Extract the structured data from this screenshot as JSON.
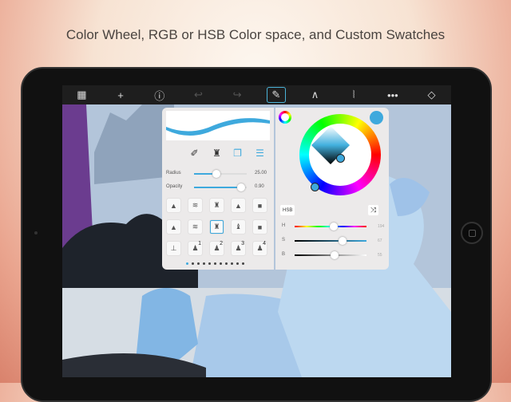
{
  "headline": "Color Wheel, RGB or HSB Color space, and Custom Swatches",
  "toolbar": [
    {
      "name": "gallery",
      "glyph": "▦"
    },
    {
      "name": "add",
      "glyph": "+"
    },
    {
      "name": "info",
      "glyph": "ⓘ"
    },
    {
      "name": "undo",
      "glyph": "↩"
    },
    {
      "name": "redo",
      "glyph": "↪"
    },
    {
      "name": "brush",
      "glyph": "✎"
    },
    {
      "name": "curve",
      "glyph": "∧"
    },
    {
      "name": "symmetry",
      "glyph": "⦚"
    },
    {
      "name": "more",
      "glyph": "•••"
    },
    {
      "name": "layers",
      "glyph": "◇"
    }
  ],
  "brush_panel": {
    "radius_label": "Radius",
    "radius_value": "25.00",
    "radius_fraction": 0.42,
    "opacity_label": "Opacity",
    "opacity_value": "0.90",
    "opacity_fraction": 0.9,
    "swatch_numbers": [
      "1",
      "2",
      "3",
      "4"
    ],
    "page_count": 11,
    "current_page": 1
  },
  "color_panel": {
    "mode_button": "HSB",
    "current_color": "#3ea9dd",
    "H_label": "H",
    "H_value": "194",
    "S_label": "S",
    "S_value": "67",
    "B_label": "B",
    "B_value": "55",
    "h_fraction": 0.54,
    "s_fraction": 0.67,
    "b_fraction": 0.55
  }
}
